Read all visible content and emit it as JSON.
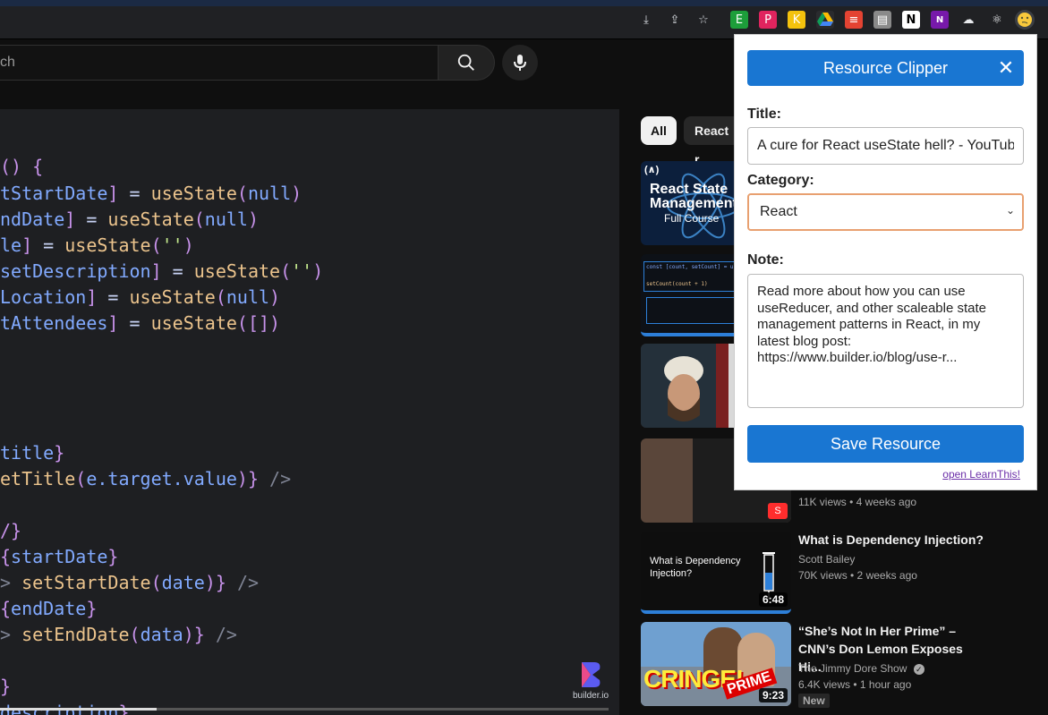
{
  "search": {
    "placeholder_fragment": "ch"
  },
  "code_lines": [
    {
      "parts": [
        [
          "pun",
          "() {"
        ]
      ]
    },
    {
      "parts": [
        [
          "var",
          "tStartDate"
        ],
        [
          "pun",
          "]"
        ],
        [
          "plain",
          " = "
        ],
        [
          "fn",
          "useState"
        ],
        [
          "pun",
          "("
        ],
        [
          "var",
          "null"
        ],
        [
          "pun",
          ")"
        ]
      ]
    },
    {
      "parts": [
        [
          "var",
          "ndDate"
        ],
        [
          "pun",
          "]"
        ],
        [
          "plain",
          " = "
        ],
        [
          "fn",
          "useState"
        ],
        [
          "pun",
          "("
        ],
        [
          "var",
          "null"
        ],
        [
          "pun",
          ")"
        ]
      ]
    },
    {
      "parts": [
        [
          "var",
          "le"
        ],
        [
          "pun",
          "]"
        ],
        [
          "plain",
          " = "
        ],
        [
          "fn",
          "useState"
        ],
        [
          "pun",
          "("
        ],
        [
          "str",
          "''"
        ],
        [
          "pun",
          ")"
        ]
      ]
    },
    {
      "parts": [
        [
          "var",
          "setDescription"
        ],
        [
          "pun",
          "]"
        ],
        [
          "plain",
          " = "
        ],
        [
          "fn",
          "useState"
        ],
        [
          "pun",
          "("
        ],
        [
          "str",
          "''"
        ],
        [
          "pun",
          ")"
        ]
      ]
    },
    {
      "parts": [
        [
          "var",
          "Location"
        ],
        [
          "pun",
          "]"
        ],
        [
          "plain",
          " = "
        ],
        [
          "fn",
          "useState"
        ],
        [
          "pun",
          "("
        ],
        [
          "var",
          "null"
        ],
        [
          "pun",
          ")"
        ]
      ]
    },
    {
      "parts": [
        [
          "var",
          "tAttendees"
        ],
        [
          "pun",
          "]"
        ],
        [
          "plain",
          " = "
        ],
        [
          "fn",
          "useState"
        ],
        [
          "pun",
          "(["
        ],
        [
          "pun",
          "])"
        ]
      ]
    },
    {
      "parts": [
        [
          "var",
          "title"
        ],
        [
          "pun",
          "}"
        ]
      ]
    },
    {
      "parts": [
        [
          "fn",
          "etTitle"
        ],
        [
          "pun",
          "("
        ],
        [
          "var",
          "e.target.value"
        ],
        [
          "pun",
          ")}"
        ],
        [
          "cmt",
          " />"
        ]
      ]
    },
    {
      "parts": [
        [
          "pun",
          "/}"
        ]
      ]
    },
    {
      "parts": [
        [
          "pun",
          "{"
        ],
        [
          "var",
          "startDate"
        ],
        [
          "pun",
          "}"
        ]
      ]
    },
    {
      "parts": [
        [
          "cmt",
          "> "
        ],
        [
          "fn",
          "setStartDate"
        ],
        [
          "pun",
          "("
        ],
        [
          "var",
          "date"
        ],
        [
          "pun",
          ")}"
        ],
        [
          "cmt",
          " />"
        ]
      ]
    },
    {
      "parts": [
        [
          "pun",
          "{"
        ],
        [
          "var",
          "endDate"
        ],
        [
          "pun",
          "}"
        ]
      ]
    },
    {
      "parts": [
        [
          "cmt",
          "> "
        ],
        [
          "fn",
          "setEndDate"
        ],
        [
          "pun",
          "("
        ],
        [
          "var",
          "data"
        ],
        [
          "pun",
          ")}"
        ],
        [
          "cmt",
          " />"
        ]
      ]
    },
    {
      "parts": [
        [
          "pun",
          "}"
        ]
      ]
    },
    {
      "parts": [
        [
          "var",
          "description"
        ],
        [
          "pun",
          "}"
        ]
      ]
    }
  ],
  "video": {
    "brand": "builder.io"
  },
  "chips": {
    "all": "All",
    "react": "React r"
  },
  "recommendations": [
    {
      "title": "",
      "meta": "",
      "duration": "",
      "thumb_text": "React State Management",
      "thumb_sub": "Full Course"
    },
    {
      "title": "",
      "meta": "",
      "duration": "",
      "thumb_text": "const [count, setCount] = u",
      "thumb_sub": "setCount(count + 1)"
    },
    {
      "title": "",
      "meta": "",
      "duration": ""
    },
    {
      "title": "",
      "meta": "11K views  •  4 weeks ago",
      "duration": ""
    },
    {
      "title": "What is Dependency Injection?",
      "channel": "Scott Bailey",
      "meta": "70K views  •  2 weeks ago",
      "duration": "6:48",
      "thumb_text": "What is Dependency Injection?"
    },
    {
      "title": "“She’s Not In Her Prime” – CNN’s Don Lemon Exposes Hi...",
      "channel": "The Jimmy Dore Show",
      "meta": "6.4K views  •  1 hour ago",
      "duration": "9:23",
      "badge": "New",
      "thumb_text": "CRINGE!",
      "thumb_sub": "PRIME"
    }
  ],
  "popup": {
    "header": "Resource Clipper",
    "close": "✕",
    "title_label": "Title:",
    "title_value": "A cure for React useState hell? - YouTube",
    "category_label": "Category:",
    "category_value": "React",
    "note_label": "Note:",
    "note_value": "Read more about how you can use useReducer, and other scaleable state management patterns in React, in my latest blog post: https://www.builder.io/blog/use-r...",
    "save": "Save Resource",
    "open_link": "open LearnThis!"
  },
  "colors": {
    "accent": "#1976d2",
    "yt_bg": "#0f0f0f",
    "code_bg": "#1e1f22"
  }
}
